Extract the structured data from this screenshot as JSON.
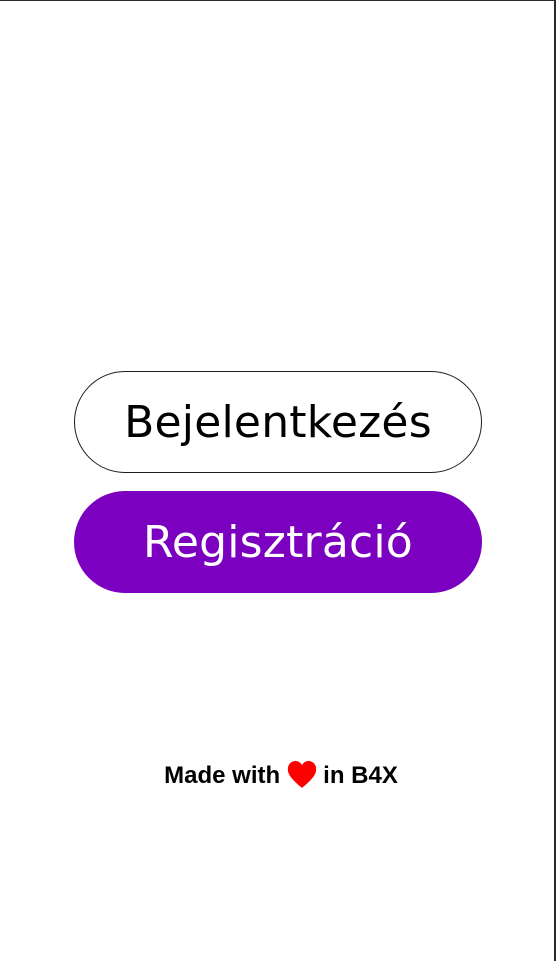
{
  "screen": {
    "login_button": "Bejelentkezés",
    "register_button": "Regisztráció"
  },
  "footer": {
    "prefix": "Made with",
    "heart_icon": "heart-icon",
    "suffix": "in B4X",
    "heart_color": "#ff0000"
  },
  "colors": {
    "accent": "#7b00bf",
    "background": "#ffffff"
  }
}
